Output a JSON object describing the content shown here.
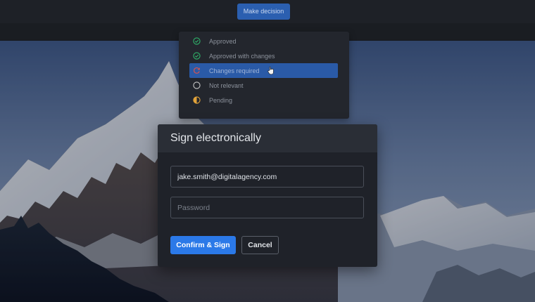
{
  "toolbar": {
    "make_decision_label": "Make decision"
  },
  "decision_menu": {
    "items": [
      {
        "label": "Approved",
        "icon": "check-circle-icon",
        "color": "#2fb36a"
      },
      {
        "label": "Approved with changes",
        "icon": "check-circle-icon",
        "color": "#2fb36a"
      },
      {
        "label": "Changes required",
        "icon": "refresh-circle-icon",
        "color": "#d9534f",
        "selected": true
      },
      {
        "label": "Not relevant",
        "icon": "empty-circle-icon",
        "color": "#c7c7c7"
      },
      {
        "label": "Pending",
        "icon": "half-circle-icon",
        "color": "#e2a33a"
      }
    ]
  },
  "sign_dialog": {
    "title": "Sign electronically",
    "email_value": "jake.smith@digitalagency.com",
    "password_placeholder": "Password",
    "confirm_label": "Confirm & Sign",
    "cancel_label": "Cancel"
  },
  "colors": {
    "accent": "#2b79e8",
    "selected_row": "#2a5aa7",
    "modal_bg": "#1f2229"
  }
}
